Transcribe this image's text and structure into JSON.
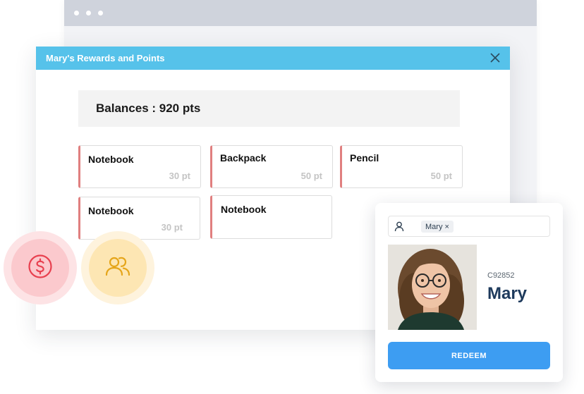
{
  "modal": {
    "title": "Mary's Rewards and Points",
    "balance": "Balances : 920 pts"
  },
  "rewards": [
    {
      "name": "Notebook",
      "points": "30 pt"
    },
    {
      "name": "Backpack",
      "points": "50 pt"
    },
    {
      "name": "Pencil",
      "points": "50 pt"
    },
    {
      "name": "Notebook",
      "points": "30 pt"
    },
    {
      "name": "Notebook",
      "points": ""
    }
  ],
  "profile": {
    "search_chip": "Mary",
    "user_id": "C92852",
    "user_name": "Mary",
    "redeem_label": "REDEEM"
  },
  "icons": {
    "close": "close-icon",
    "person": "person-icon",
    "dollar": "dollar-icon",
    "users": "users-icon"
  },
  "colors": {
    "header": "#56c2ea",
    "accent_card": "#e07f7f",
    "redeem": "#3d9df2",
    "dollar": "#e8404f",
    "users": "#e5a51a"
  }
}
